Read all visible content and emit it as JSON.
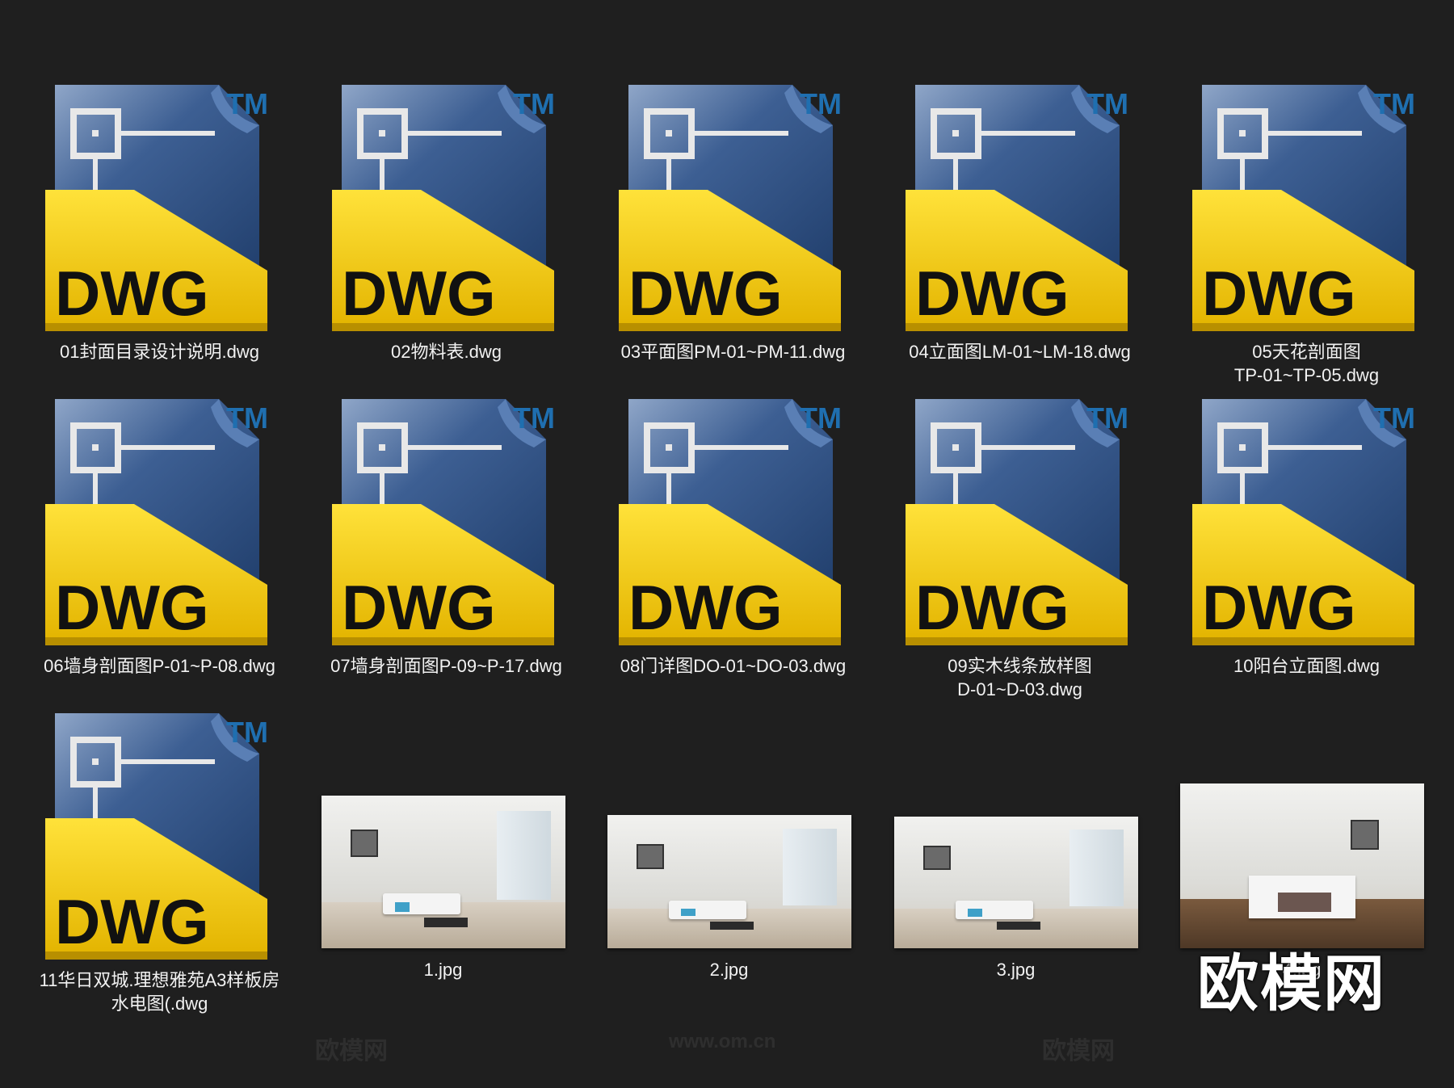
{
  "files": [
    {
      "name": "01封面目录设计说明.dwg",
      "type": "dwg",
      "icon_text": "DWG",
      "tm": "TM"
    },
    {
      "name": "02物料表.dwg",
      "type": "dwg",
      "icon_text": "DWG",
      "tm": "TM"
    },
    {
      "name": "03平面图PM-01~PM-11.dwg",
      "type": "dwg",
      "icon_text": "DWG",
      "tm": "TM"
    },
    {
      "name": "04立面图LM-01~LM-18.dwg",
      "type": "dwg",
      "icon_text": "DWG",
      "tm": "TM"
    },
    {
      "name": "05天花剖面图 TP-01~TP-05.dwg",
      "type": "dwg",
      "icon_text": "DWG",
      "tm": "TM"
    },
    {
      "name": "06墙身剖面图P-01~P-08.dwg",
      "type": "dwg",
      "icon_text": "DWG",
      "tm": "TM"
    },
    {
      "name": "07墙身剖面图P-09~P-17.dwg",
      "type": "dwg",
      "icon_text": "DWG",
      "tm": "TM"
    },
    {
      "name": "08门详图DO-01~DO-03.dwg",
      "type": "dwg",
      "icon_text": "DWG",
      "tm": "TM"
    },
    {
      "name": "09实木线条放样图 D-01~D-03.dwg",
      "type": "dwg",
      "icon_text": "DWG",
      "tm": "TM"
    },
    {
      "name": "10阳台立面图.dwg",
      "type": "dwg",
      "icon_text": "DWG",
      "tm": "TM"
    },
    {
      "name": "11华日双城.理想雅苑A3样板房 水电图(.dwg",
      "type": "dwg",
      "icon_text": "DWG",
      "tm": "TM"
    },
    {
      "name": "1.jpg",
      "type": "jpg"
    },
    {
      "name": "2.jpg",
      "type": "jpg"
    },
    {
      "name": "3.jpg",
      "type": "jpg"
    },
    {
      "name": "4.jpg",
      "type": "jpg"
    }
  ],
  "watermark": {
    "logo": "欧模网",
    "site": "www.om.cn"
  },
  "colors": {
    "background": "#1f1f1f",
    "dwg_yellow": "#f2c80f",
    "dwg_blue": "#2d4a7a",
    "tm_blue": "#1f6fb0"
  }
}
